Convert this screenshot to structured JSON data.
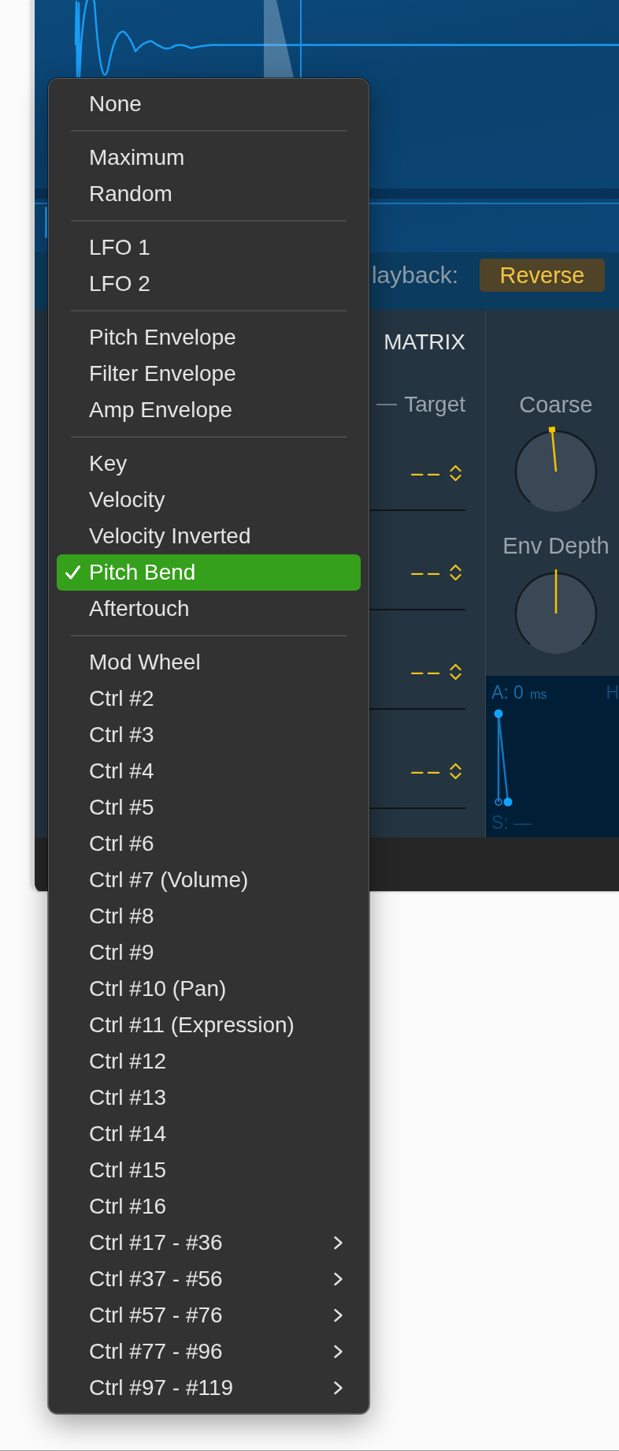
{
  "playback": {
    "label": "layback:",
    "button": "Reverse"
  },
  "mod_matrix": {
    "title": "MATRIX",
    "target_header": "Target",
    "rows": [
      {
        "target": "--"
      },
      {
        "target": "--"
      },
      {
        "target": "--"
      },
      {
        "target": "--"
      }
    ]
  },
  "knobs": [
    {
      "label": "Coarse",
      "level": 0.48,
      "marker": true
    },
    {
      "label": "Env Depth",
      "level": 0.5,
      "marker": false
    }
  ],
  "envelope": {
    "attack": "A: 0",
    "attack_unit": "ms",
    "partial_label": "H",
    "sustain": "S: —"
  },
  "menu": {
    "groups": [
      {
        "items": [
          {
            "label": "None",
            "selected": false,
            "submenu": false
          }
        ]
      },
      {
        "items": [
          {
            "label": "Maximum",
            "selected": false,
            "submenu": false
          },
          {
            "label": "Random",
            "selected": false,
            "submenu": false
          }
        ]
      },
      {
        "items": [
          {
            "label": "LFO 1",
            "selected": false,
            "submenu": false
          },
          {
            "label": "LFO 2",
            "selected": false,
            "submenu": false
          }
        ]
      },
      {
        "items": [
          {
            "label": "Pitch Envelope",
            "selected": false,
            "submenu": false
          },
          {
            "label": "Filter Envelope",
            "selected": false,
            "submenu": false
          },
          {
            "label": "Amp Envelope",
            "selected": false,
            "submenu": false
          }
        ]
      },
      {
        "items": [
          {
            "label": "Key",
            "selected": false,
            "submenu": false
          },
          {
            "label": "Velocity",
            "selected": false,
            "submenu": false
          },
          {
            "label": "Velocity Inverted",
            "selected": false,
            "submenu": false
          },
          {
            "label": "Pitch Bend",
            "selected": true,
            "submenu": false
          },
          {
            "label": "Aftertouch",
            "selected": false,
            "submenu": false
          }
        ]
      },
      {
        "items": [
          {
            "label": "Mod Wheel",
            "selected": false,
            "submenu": false
          },
          {
            "label": "Ctrl #2",
            "selected": false,
            "submenu": false
          },
          {
            "label": "Ctrl #3",
            "selected": false,
            "submenu": false
          },
          {
            "label": "Ctrl #4",
            "selected": false,
            "submenu": false
          },
          {
            "label": "Ctrl #5",
            "selected": false,
            "submenu": false
          },
          {
            "label": "Ctrl #6",
            "selected": false,
            "submenu": false
          },
          {
            "label": "Ctrl #7 (Volume)",
            "selected": false,
            "submenu": false
          },
          {
            "label": "Ctrl #8",
            "selected": false,
            "submenu": false
          },
          {
            "label": "Ctrl #9",
            "selected": false,
            "submenu": false
          },
          {
            "label": "Ctrl #10 (Pan)",
            "selected": false,
            "submenu": false
          },
          {
            "label": "Ctrl #11 (Expression)",
            "selected": false,
            "submenu": false
          },
          {
            "label": "Ctrl #12",
            "selected": false,
            "submenu": false
          },
          {
            "label": "Ctrl #13",
            "selected": false,
            "submenu": false
          },
          {
            "label": "Ctrl #14",
            "selected": false,
            "submenu": false
          },
          {
            "label": "Ctrl #15",
            "selected": false,
            "submenu": false
          },
          {
            "label": "Ctrl #16",
            "selected": false,
            "submenu": false
          },
          {
            "label": "Ctrl #17 - #36",
            "selected": false,
            "submenu": true
          },
          {
            "label": "Ctrl #37 - #56",
            "selected": false,
            "submenu": true
          },
          {
            "label": "Ctrl #57 - #76",
            "selected": false,
            "submenu": true
          },
          {
            "label": "Ctrl #77 - #96",
            "selected": false,
            "submenu": true
          },
          {
            "label": "Ctrl #97 - #119",
            "selected": false,
            "submenu": true
          }
        ]
      }
    ]
  }
}
